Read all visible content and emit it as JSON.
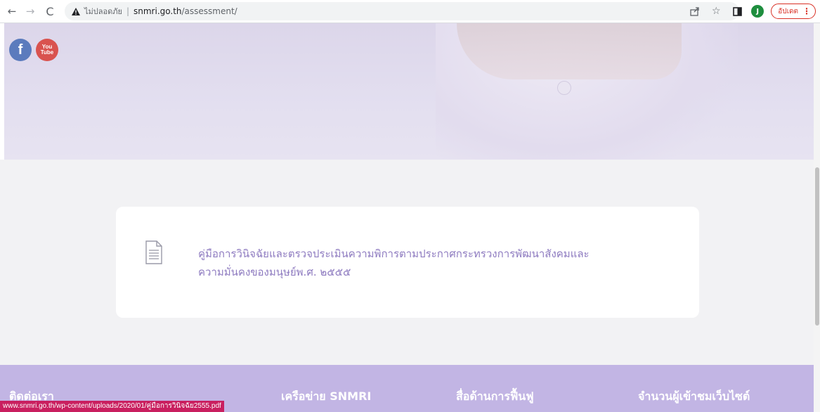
{
  "browser": {
    "security_warning": "ไม่ปลอดภัย",
    "url_host": "snmri.go.th",
    "url_path": "/assessment/",
    "avatar_letter": "J",
    "update_label": "อัปเดต"
  },
  "social": {
    "facebook_glyph": "f",
    "youtube_line1": "You",
    "youtube_line2": "Tube"
  },
  "content": {
    "document_title_line1": "คู่มือการวินิจฉัยและตรวจประเมินความพิการตามประกาศกระทรวงการพัฒนาสังคมและ",
    "document_title_line2": "ความมั่นคงของมนุษย์พ.ศ. ๒๕๕๕"
  },
  "footer": {
    "contact": "ติดต่อเรา",
    "network": "เครือข่าย SNMRI",
    "rehab_media": "สื่อด้านการฟื้นฟู",
    "visitors": "จำนวนผู้เข้าชมเว็บไซต์"
  },
  "status_bar": {
    "hover_url": "www.snmri.go.th/wp-content/uploads/2020/01/คู่มือการวินิจฉัย2555.pdf"
  },
  "colors": {
    "accent_purple": "#8e7bc0",
    "footer_bg": "#c2b5e4",
    "status_pink": "#c91f5f"
  }
}
